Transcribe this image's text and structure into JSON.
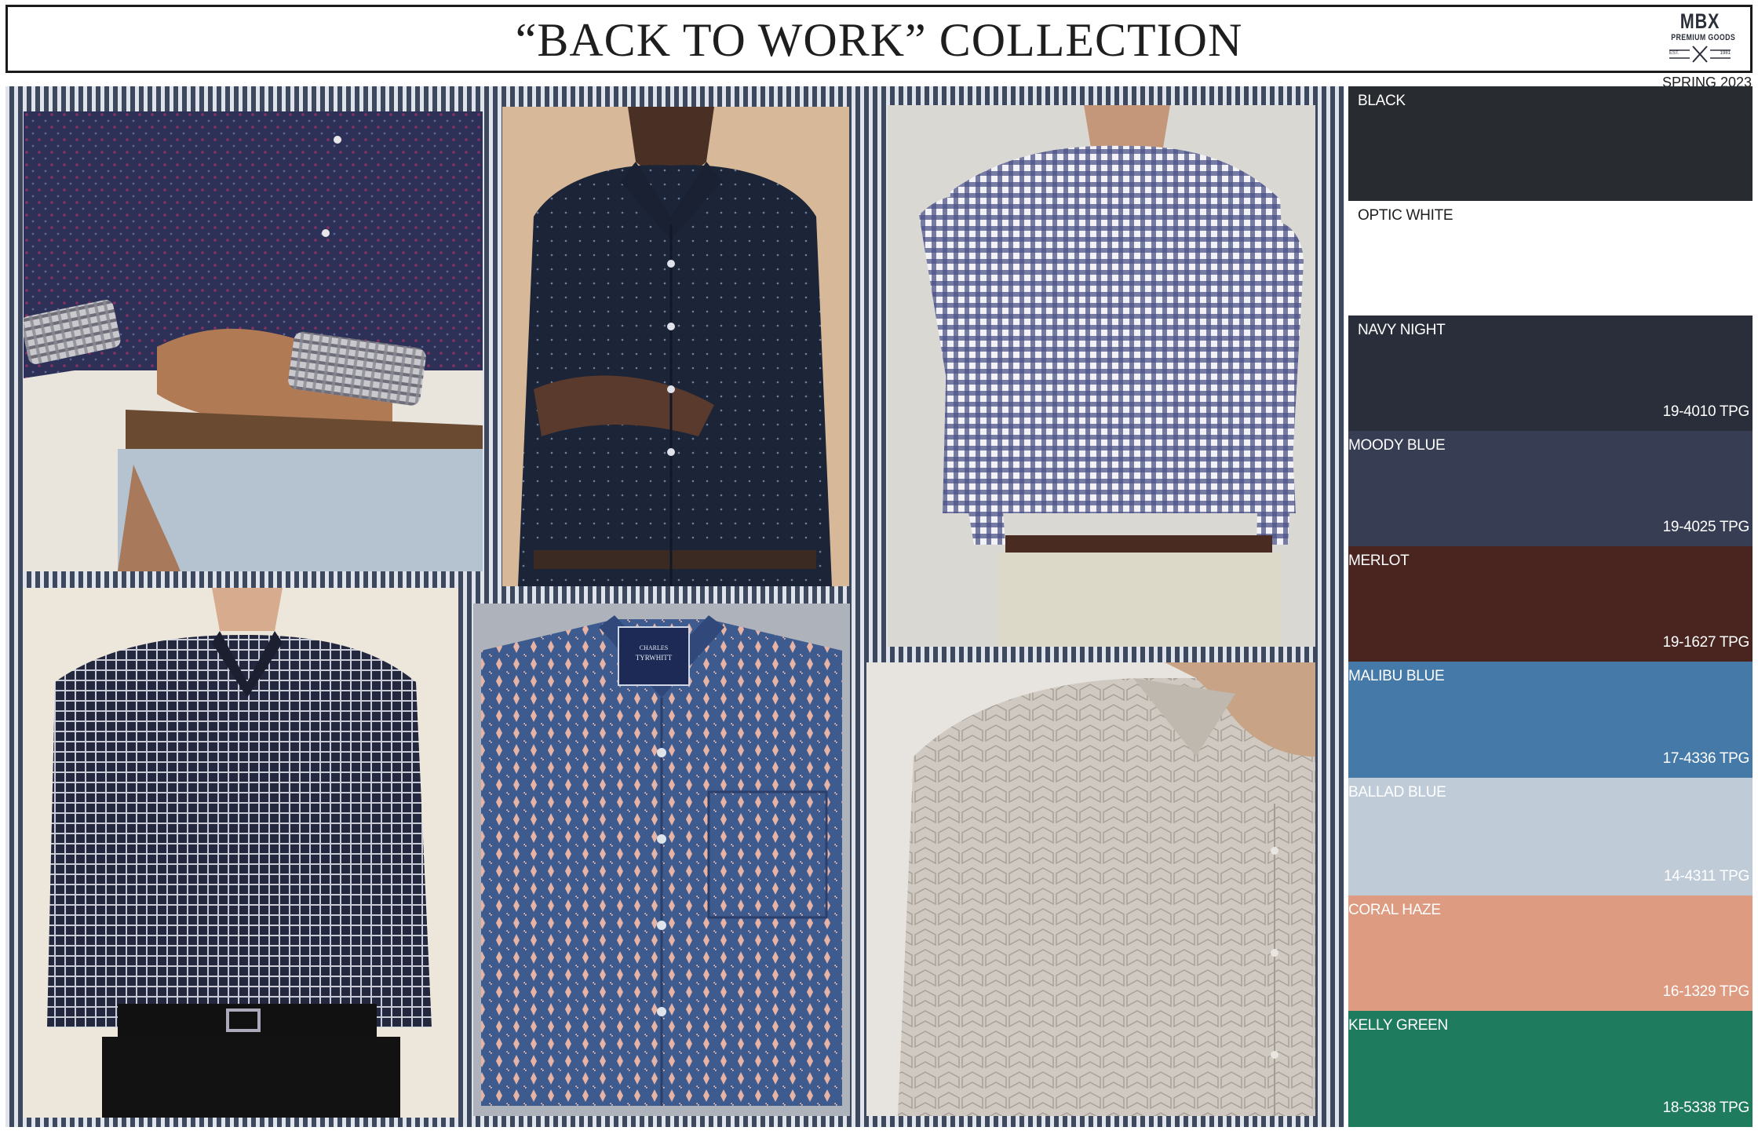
{
  "header": {
    "title": "“BACK TO WORK” COLLECTION",
    "logo": {
      "mark": "MBX",
      "tagline": "PREMIUM GOODS",
      "est_left": "EST.",
      "est_right": "1981"
    },
    "season": "SPRING 2023"
  },
  "photos": [
    {
      "name": "photo-navy-micro-print-shirt-cuff",
      "icon": "shirt-photo"
    },
    {
      "name": "photo-navy-dot-dress-shirt",
      "icon": "shirt-photo"
    },
    {
      "name": "photo-blue-gingham-shirt-back",
      "icon": "shirt-photo"
    },
    {
      "name": "photo-navy-windowpane-check-shirt",
      "icon": "shirt-photo"
    },
    {
      "name": "photo-folded-blue-print-shirt",
      "icon": "shirt-photo",
      "label_line1": "CHARLES",
      "label_line2": "TYRWHITT"
    },
    {
      "name": "photo-grey-geometric-shirt",
      "icon": "shirt-photo"
    }
  ],
  "palette": [
    {
      "name": "BLACK",
      "code": "",
      "color": "#282b30",
      "text_color": "#ffffff"
    },
    {
      "name": "OPTIC WHITE",
      "code": "",
      "color": "#ffffff",
      "text_color": "#1e1e1e"
    },
    {
      "name": "NAVY NIGHT",
      "code": "19-4010 TPG",
      "color": "#292e3a",
      "text_color": "#ffffff"
    },
    {
      "name": "MOODY BLUE",
      "code": "19-4025 TPG",
      "color": "#373d52",
      "text_color": "#ffffff"
    },
    {
      "name": "MERLOT",
      "code": "19-1627 TPG",
      "color": "#4a241f",
      "text_color": "#ffffff"
    },
    {
      "name": "MALIBU BLUE",
      "code": "17-4336 TPG",
      "color": "#4479a8",
      "text_color": "#ffffff"
    },
    {
      "name": "BALLAD BLUE",
      "code": "14-4311 TPG",
      "color": "#bfccd8",
      "text_color": "#ffffff"
    },
    {
      "name": "CORAL HAZE",
      "code": "16-1329 TPG",
      "color": "#dd9b82",
      "text_color": "#ffffff"
    },
    {
      "name": "KELLY GREEN",
      "code": "18-5338 TPG",
      "color": "#1f7b5d",
      "text_color": "#ffffff"
    }
  ]
}
